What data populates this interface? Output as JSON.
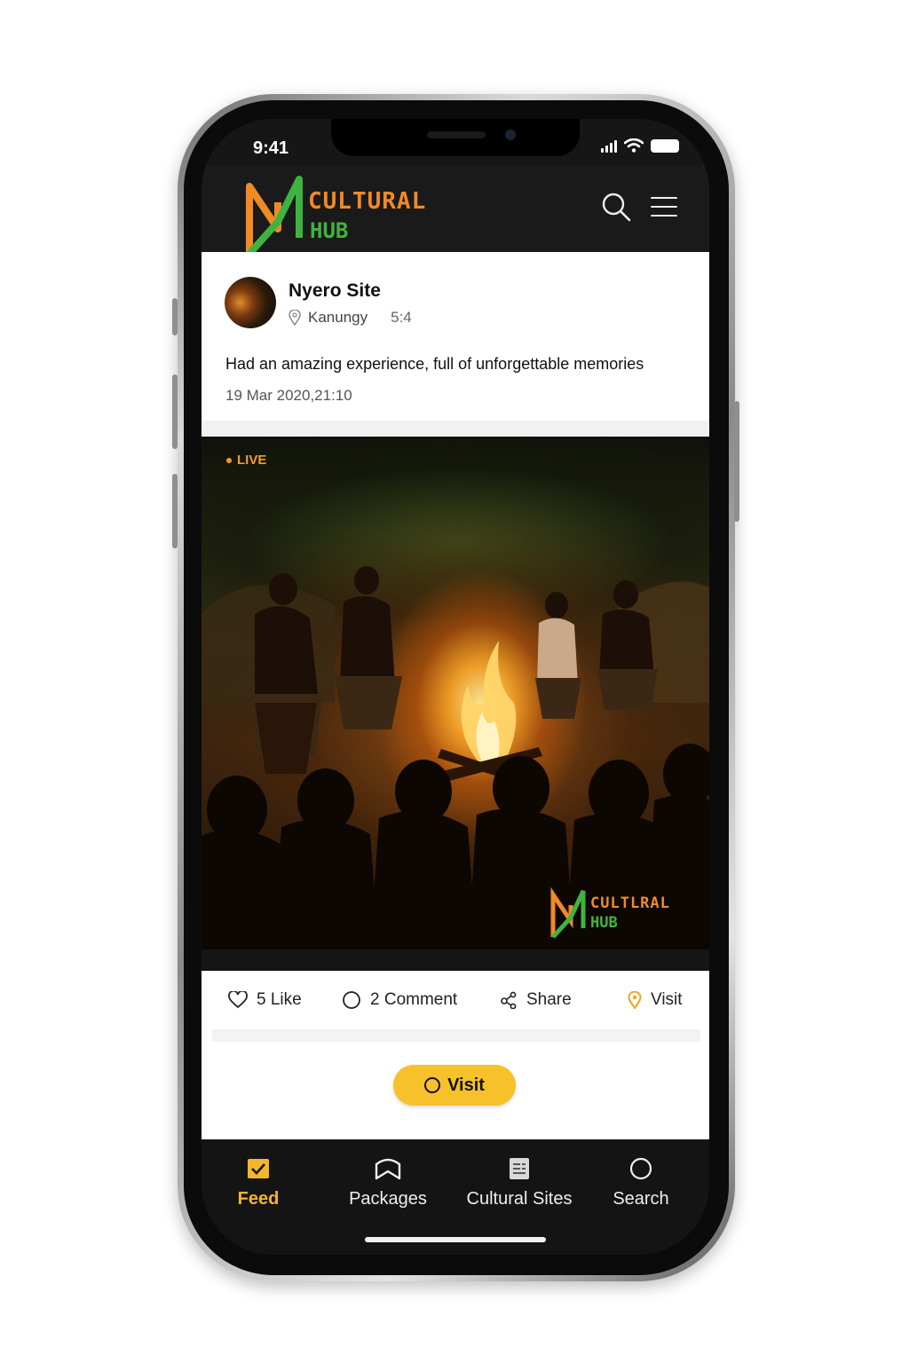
{
  "status_bar": {
    "time": "9:41"
  },
  "brand": {
    "line1": "CULTURAL",
    "line2": "HUB",
    "orange": "#f08a24",
    "green": "#3fb33f"
  },
  "header": {
    "search_icon": "search-icon",
    "menu_icon": "hamburger-menu-icon"
  },
  "post": {
    "title": "Nyero Site",
    "location": "Kanungy",
    "distance": "5:4",
    "text": "Had an amazing experience, full of unforgettable memories",
    "date": "19 Mar 2020,21:10"
  },
  "media": {
    "live_label": "LIVE",
    "watermark_line1": "CULTLRAL",
    "watermark_line2": "HUB"
  },
  "actions": {
    "like": "5 Like",
    "comment": "2 Comment",
    "share": "Share",
    "visit": "Visit"
  },
  "visit_button": {
    "label": "Visit",
    "color": "#f7c12b"
  },
  "bottom_nav": {
    "items": [
      {
        "label": "Feed",
        "icon": "feed-icon",
        "active": true
      },
      {
        "label": "Packages",
        "icon": "packages-icon",
        "active": false
      },
      {
        "label": "Cultural Sites",
        "icon": "cultural-sites-icon",
        "active": false
      },
      {
        "label": "Search",
        "icon": "search-icon",
        "active": false
      }
    ],
    "active_color": "#f5b52a"
  }
}
